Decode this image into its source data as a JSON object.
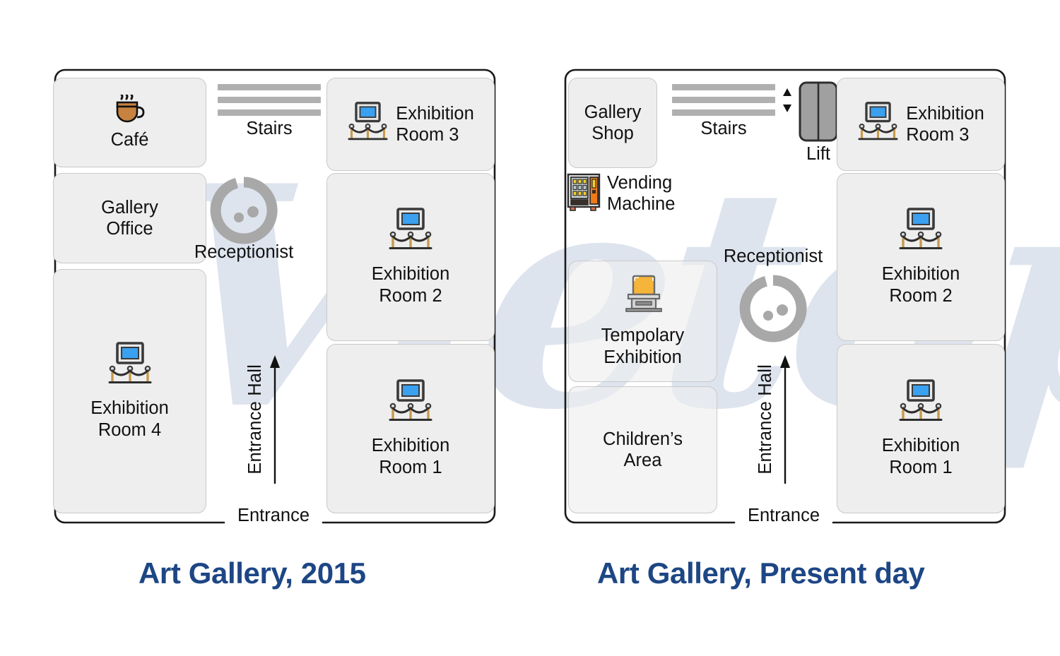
{
  "diagram": {
    "title_left": "Art Gallery, 2015",
    "title_right": "Art Gallery, Present day",
    "watermark_text": "Vietop",
    "accent_color": "#1d4685",
    "room_fill": "#eeeeee",
    "artwork_blue": "#3aa0f0",
    "stairs_grey": "#b0b0b0"
  },
  "left_plan": {
    "name": "Art Gallery 2015 floor plan",
    "entrance_label": "Entrance",
    "entrance_hall_label": "Entrance Hall",
    "stairs_label": "Stairs",
    "receptionist_label": "Receptionist",
    "rooms": [
      {
        "id": "cafe",
        "label": "Café",
        "icon": "coffee-cup-icon"
      },
      {
        "id": "office",
        "label": "Gallery\nOffice",
        "icon": "none"
      },
      {
        "id": "room4",
        "label": "Exhibition\nRoom 4",
        "icon": "artwork-stanchion-icon"
      },
      {
        "id": "room3",
        "label": "Exhibition\nRoom 3",
        "icon": "artwork-stanchion-icon"
      },
      {
        "id": "room2",
        "label": "Exhibition\nRoom 2",
        "icon": "artwork-stanchion-icon"
      },
      {
        "id": "room1",
        "label": "Exhibition\nRoom 1",
        "icon": "artwork-stanchion-icon"
      }
    ]
  },
  "right_plan": {
    "name": "Art Gallery present day floor plan",
    "entrance_label": "Entrance",
    "entrance_hall_label": "Entrance Hall",
    "stairs_label": "Stairs",
    "lift_label": "Lift",
    "receptionist_label": "Receptionist",
    "vending_label": "Vending\nMachine",
    "rooms": [
      {
        "id": "shop",
        "label": "Gallery\nShop",
        "icon": "none"
      },
      {
        "id": "temporary",
        "label": "Tempolary\nExhibition",
        "icon": "display-case-icon"
      },
      {
        "id": "children",
        "label": "Children’s\nArea",
        "icon": "none"
      },
      {
        "id": "room3",
        "label": "Exhibition\nRoom 3",
        "icon": "artwork-stanchion-icon"
      },
      {
        "id": "room2",
        "label": "Exhibition\nRoom 2",
        "icon": "artwork-stanchion-icon"
      },
      {
        "id": "room1",
        "label": "Exhibition\nRoom 1",
        "icon": "artwork-stanchion-icon"
      }
    ]
  }
}
